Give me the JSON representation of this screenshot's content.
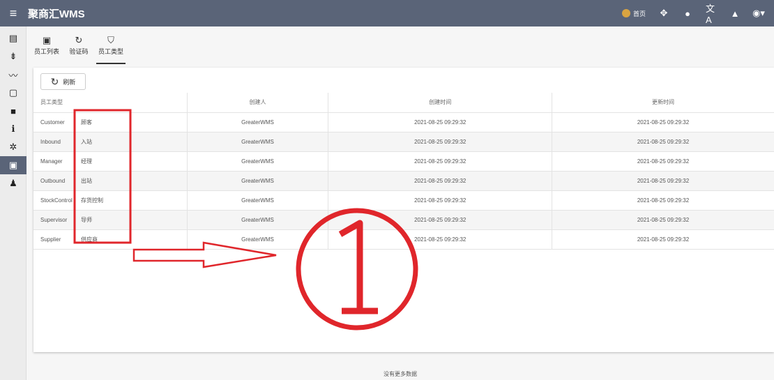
{
  "app": {
    "title": "聚商汇WMS"
  },
  "topbar": {
    "home_label": "首页",
    "icons": [
      "translate-icon",
      "sitemap-icon",
      "github-icon",
      "bell-icon",
      "account-icon"
    ]
  },
  "sidebar": {
    "items": [
      "chat-icon",
      "forklift-icon",
      "trend-icon",
      "devices-icon",
      "briefcase-icon",
      "info-icon",
      "settings-icon",
      "badge-icon",
      "person-icon"
    ],
    "active_index": 7
  },
  "tabs": [
    {
      "label": "员工列表",
      "icon": "badge-icon"
    },
    {
      "label": "验证码",
      "icon": "check-cycle-icon"
    },
    {
      "label": "员工类型",
      "icon": "shield-icon"
    }
  ],
  "toolbar": {
    "refresh_label": "刷新"
  },
  "table": {
    "headers": [
      "员工类型",
      "创建人",
      "创建时间",
      "更新时间"
    ],
    "rows": [
      {
        "type_en": "Customer",
        "type_zh": "顾客",
        "creator": "GreaterWMS",
        "created": "2021-08-25 09:29:32",
        "updated": "2021-08-25 09:29:32"
      },
      {
        "type_en": "Inbound",
        "type_zh": "入站",
        "creator": "GreaterWMS",
        "created": "2021-08-25 09:29:32",
        "updated": "2021-08-25 09:29:32"
      },
      {
        "type_en": "Manager",
        "type_zh": "经理",
        "creator": "GreaterWMS",
        "created": "2021-08-25 09:29:32",
        "updated": "2021-08-25 09:29:32"
      },
      {
        "type_en": "Outbound",
        "type_zh": "出站",
        "creator": "GreaterWMS",
        "created": "2021-08-25 09:29:32",
        "updated": "2021-08-25 09:29:32"
      },
      {
        "type_en": "StockControl",
        "type_zh": "存货控制",
        "creator": "GreaterWMS",
        "created": "2021-08-25 09:29:32",
        "updated": "2021-08-25 09:29:32"
      },
      {
        "type_en": "Supervisor",
        "type_zh": "导师",
        "creator": "GreaterWMS",
        "created": "2021-08-25 09:29:32",
        "updated": "2021-08-25 09:29:32"
      },
      {
        "type_en": "Supplier",
        "type_zh": "供应商",
        "creator": "GreaterWMS",
        "created": "2021-08-25 09:29:32",
        "updated": "2021-08-25 09:29:32"
      }
    ]
  },
  "footer": {
    "no_more": "没有更多数据"
  },
  "annotation": {
    "marker": "①",
    "color": "#e0262b"
  }
}
